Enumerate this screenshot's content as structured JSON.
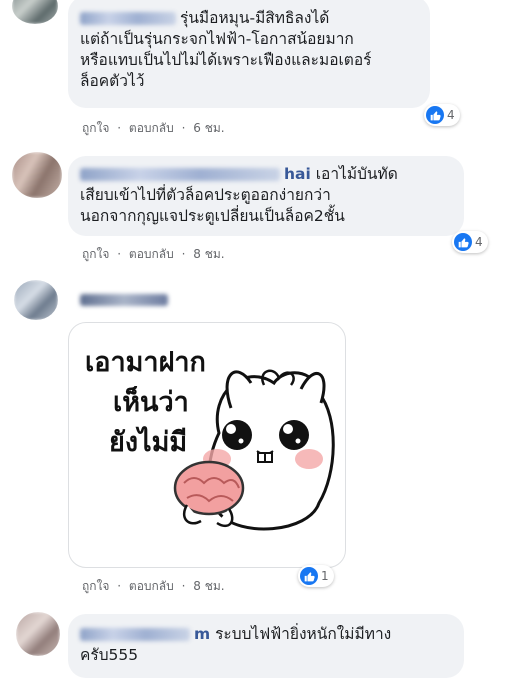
{
  "comments": [
    {
      "id": "c1",
      "name_visible": "",
      "text_lines": [
        "รุ่นมือหมุน-มีสิทธิลงได้",
        "แต่ถ้าเป็นรุ่นกระจกไฟฟ้า-โอกาสน้อยมาก",
        "หรือแทบเป็นไปไม่ได้เพราะเฟืองและมอเตอร์",
        "ล็อคตัวไว้"
      ],
      "like_label": "ถูกใจ",
      "reply_label": "ตอบกลับ",
      "time": "6 ชม.",
      "reaction_count": "4"
    },
    {
      "id": "c2",
      "name_visible": "hai",
      "text_lines": [
        "เอาไม้บันทัด",
        "เสียบเข้าไปที่ตัวล็อคประตูออกง่ายกว่า",
        "นอกจากกุญแจประตูเปลี่ยนเป็นล็อค2ชั้น"
      ],
      "like_label": "ถูกใจ",
      "reply_label": "ตอบกลับ",
      "time": "8 ชม.",
      "reaction_count": "4"
    },
    {
      "id": "c3",
      "name_visible": "",
      "sticker_text_lines": [
        "เอามาฝาก",
        "เห็นว่า",
        "ยังไม่มี"
      ],
      "like_label": "ถูกใจ",
      "reply_label": "ตอบกลับ",
      "time": "8 ชม.",
      "reaction_count": "1"
    },
    {
      "id": "c4",
      "name_visible": "m",
      "text_lines": [
        "ระบบไฟฟ้ายิ่งหนักใม่มีทาง",
        "ครับ555"
      ]
    }
  ],
  "separator": "·",
  "colors": {
    "bubble_bg": "#f0f2f5",
    "name": "#385898",
    "meta": "#65676b",
    "like_blue": "#1877f2"
  },
  "icons": {
    "reaction": "like-thumb-icon"
  }
}
